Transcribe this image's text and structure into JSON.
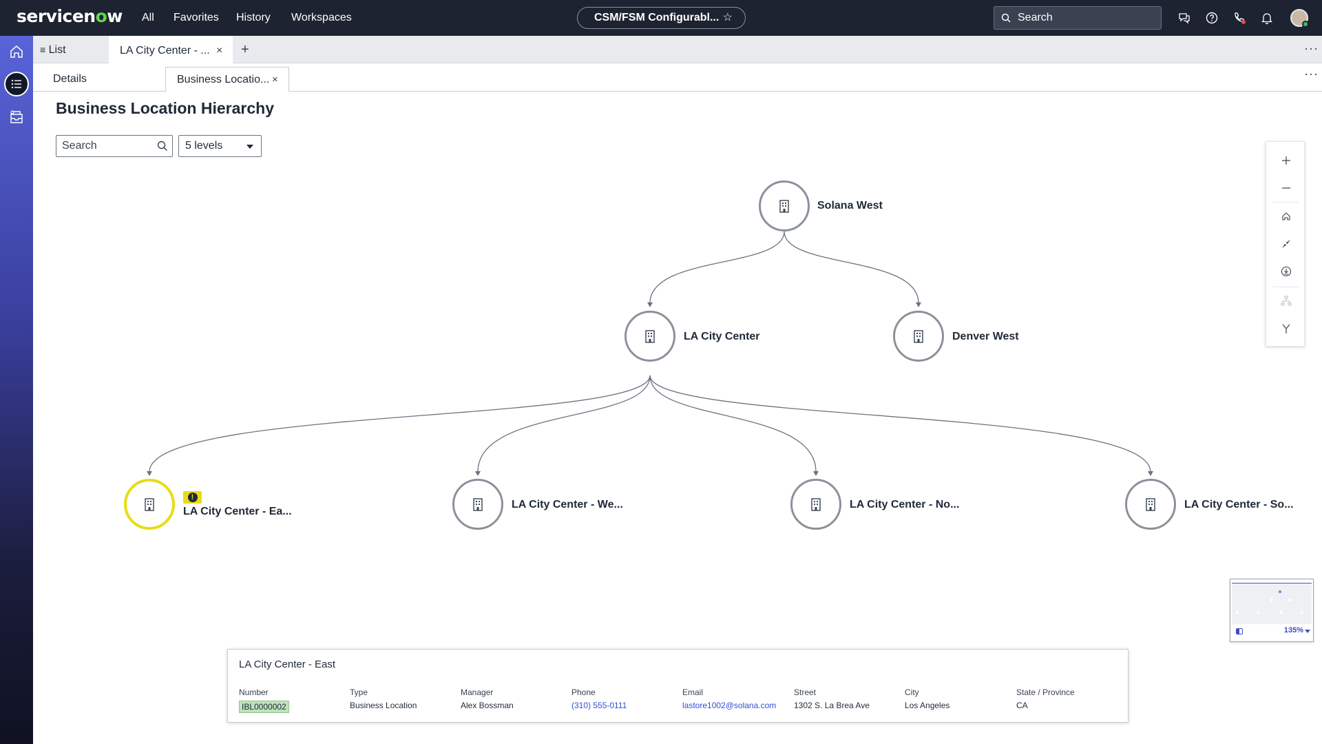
{
  "topbar": {
    "logo_text": "servicenow",
    "nav": [
      "All",
      "Favorites",
      "History",
      "Workspaces"
    ],
    "context_pill": "CSM/FSM Configurabl...",
    "search_placeholder": "Search"
  },
  "tabs": {
    "list_label": "List",
    "record_tab_label": "LA City Center - ...",
    "details_label": "Details",
    "business_tab_label": "Business Locatio..."
  },
  "main": {
    "title": "Business Location Hierarchy",
    "search_placeholder": "Search",
    "levels_value": "5 levels"
  },
  "hierarchy": {
    "root": {
      "label": "Solana West"
    },
    "level2": [
      {
        "label": "LA City Center"
      },
      {
        "label": "Denver West"
      }
    ],
    "level3": [
      {
        "label": "LA City Center - Ea...",
        "selected": true,
        "warning": true
      },
      {
        "label": "LA City Center - We..."
      },
      {
        "label": "LA City Center - No..."
      },
      {
        "label": "LA City Center - So..."
      }
    ],
    "selected_color": "#e8dc16"
  },
  "minimap": {
    "zoom": "135%"
  },
  "detail": {
    "title": "LA City Center - East",
    "fields": [
      {
        "label": "Number",
        "value": "IBL0000002"
      },
      {
        "label": "Type",
        "value": "Business Location"
      },
      {
        "label": "Manager",
        "value": "Alex Bossman"
      },
      {
        "label": "Phone",
        "value": "(310) 555-0111"
      },
      {
        "label": "Email",
        "value": "lastore1002@solana.com"
      },
      {
        "label": "Street",
        "value": "1302 S. La Brea Ave"
      },
      {
        "label": "City",
        "value": "Los Angeles"
      },
      {
        "label": "State / Province",
        "value": "CA"
      }
    ]
  },
  "colors": {
    "topbar": "#1d2330",
    "accent_green": "#62d84e",
    "link": "#2f4fd6",
    "sidebar_top": "#5864d8",
    "sidebar_bottom": "#0f1122"
  },
  "icons": [
    "search-icon",
    "chat-icon",
    "help-icon",
    "phone-icon",
    "bell-icon",
    "home-icon",
    "list-icon",
    "inbox-icon",
    "building-icon",
    "zoom-in-icon",
    "zoom-out-icon",
    "fit-home-icon",
    "collapse-icon",
    "download-icon",
    "hierarchy-icon",
    "branch-icon",
    "star-icon"
  ]
}
